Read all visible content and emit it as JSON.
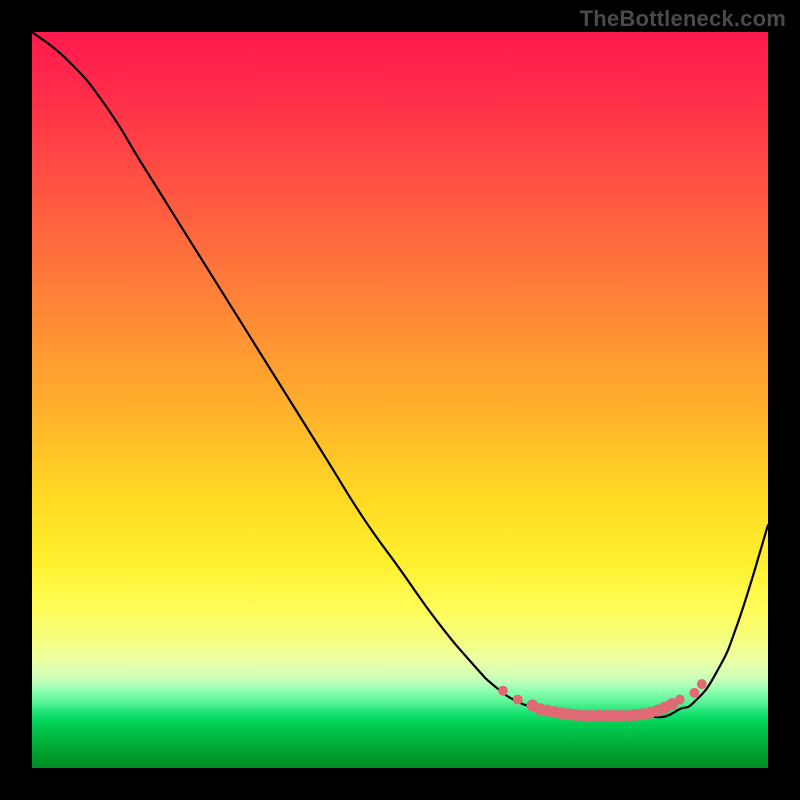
{
  "attribution": "TheBottleneck.com",
  "chart_data": {
    "type": "line",
    "title": "",
    "xlabel": "",
    "ylabel": "",
    "xlim": [
      0,
      100
    ],
    "ylim": [
      0,
      100
    ],
    "legend": false,
    "grid": false,
    "series": [
      {
        "name": "bottleneck-curve",
        "x": [
          0,
          5,
          10,
          15,
          20,
          25,
          30,
          35,
          40,
          45,
          50,
          55,
          60,
          63,
          66,
          69,
          72,
          74,
          76,
          78,
          80,
          82,
          84,
          86,
          88,
          90,
          93,
          96,
          100
        ],
        "y": [
          100,
          96,
          90,
          82,
          74,
          66,
          58,
          50,
          42,
          34,
          27,
          20,
          14,
          11,
          9,
          8,
          7,
          7,
          7,
          7,
          7,
          7,
          7,
          7,
          8,
          9,
          13,
          20,
          33
        ]
      }
    ],
    "markers": {
      "name": "highlight-dots",
      "x": [
        64,
        66,
        68,
        69,
        70,
        71,
        72,
        73,
        74,
        75,
        76,
        77,
        78,
        79,
        80,
        81,
        82,
        83,
        84,
        85,
        86,
        87,
        88,
        90,
        91
      ],
      "y": [
        10.5,
        9.3,
        8.5,
        8.0,
        7.8,
        7.6,
        7.4,
        7.3,
        7.2,
        7.1,
        7.1,
        7.1,
        7.1,
        7.1,
        7.1,
        7.1,
        7.2,
        7.3,
        7.5,
        7.8,
        8.2,
        8.7,
        9.3,
        10.2,
        11.4
      ],
      "r": [
        5,
        5,
        6,
        6,
        6,
        6,
        6,
        6,
        6,
        6,
        6,
        6,
        6,
        6,
        6,
        6,
        6,
        6,
        6,
        6,
        6,
        6,
        5,
        5,
        5
      ]
    },
    "annotations": []
  }
}
